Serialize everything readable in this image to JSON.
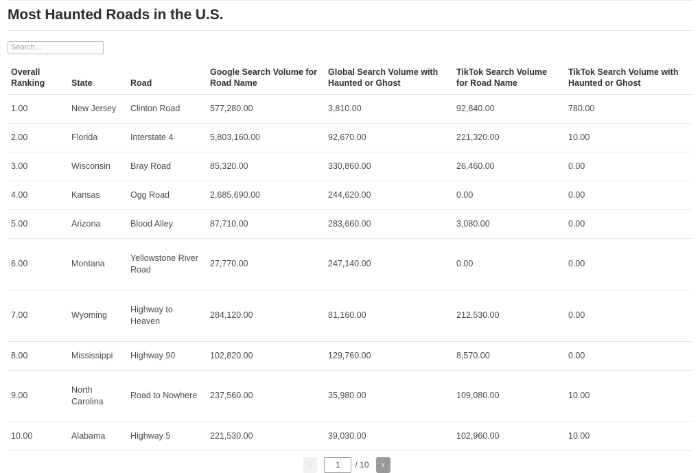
{
  "header": {
    "title": "Most Haunted Roads in the U.S."
  },
  "search": {
    "placeholder": "Search...",
    "value": ""
  },
  "table": {
    "columns": [
      "Overall Ranking",
      "State",
      "Road",
      "Google Search Volume for Road Name",
      "Global Search Volume with Haunted or Ghost",
      "TikTok Search Volume for Road Name",
      "TikTok Search Volume with Haunted or Ghost"
    ],
    "rows": [
      {
        "rank": "1.00",
        "state": "New Jersey",
        "road": "Clinton Road",
        "google_road": "577,280.00",
        "global_haunted": "3,810.00",
        "tiktok_road": "92,840.00",
        "tiktok_haunted": "780.00"
      },
      {
        "rank": "2.00",
        "state": "Florida",
        "road": "Interstate 4",
        "google_road": "5,803,160.00",
        "global_haunted": "92,670.00",
        "tiktok_road": "221,320.00",
        "tiktok_haunted": "10.00"
      },
      {
        "rank": "3.00",
        "state": "Wisconsin",
        "road": "Bray Road",
        "google_road": "85,320.00",
        "global_haunted": "330,860.00",
        "tiktok_road": "26,460.00",
        "tiktok_haunted": "0.00"
      },
      {
        "rank": "4.00",
        "state": "Kansas",
        "road": "Ogg Road",
        "google_road": "2,685,690.00",
        "global_haunted": "244,620.00",
        "tiktok_road": "0.00",
        "tiktok_haunted": "0.00"
      },
      {
        "rank": "5.00",
        "state": "Arizona",
        "road": "Blood Alley",
        "google_road": "87,710.00",
        "global_haunted": "283,660.00",
        "tiktok_road": "3,080.00",
        "tiktok_haunted": "0.00"
      },
      {
        "rank": "6.00",
        "state": "Montana",
        "road": "Yellowstone River Road",
        "google_road": "27,770.00",
        "global_haunted": "247,140.00",
        "tiktok_road": "0.00",
        "tiktok_haunted": "0.00"
      },
      {
        "rank": "7.00",
        "state": "Wyoming",
        "road": "Highway to Heaven",
        "google_road": "284,120.00",
        "global_haunted": "81,160.00",
        "tiktok_road": "212,530.00",
        "tiktok_haunted": "0.00"
      },
      {
        "rank": "8.00",
        "state": "Mississippi",
        "road": "Highway 90",
        "google_road": "102,820.00",
        "global_haunted": "129,760.00",
        "tiktok_road": "8,570.00",
        "tiktok_haunted": "0.00"
      },
      {
        "rank": "9.00",
        "state": "North Carolina",
        "road": "Road to Nowhere",
        "google_road": "237,560.00",
        "global_haunted": "35,980.00",
        "tiktok_road": "109,080.00",
        "tiktok_haunted": "10.00"
      },
      {
        "rank": "10.00",
        "state": "Alabama",
        "road": "Highway 5",
        "google_road": "221,530.00",
        "global_haunted": "39,030.00",
        "tiktok_road": "102,960.00",
        "tiktok_haunted": "10.00"
      }
    ]
  },
  "pagination": {
    "prev_label": "‹",
    "next_label": "›",
    "current_page": "1",
    "total_label": "/ 10",
    "prev_disabled_color": "#f1f1f1",
    "next_color": "#9a9a9a"
  }
}
